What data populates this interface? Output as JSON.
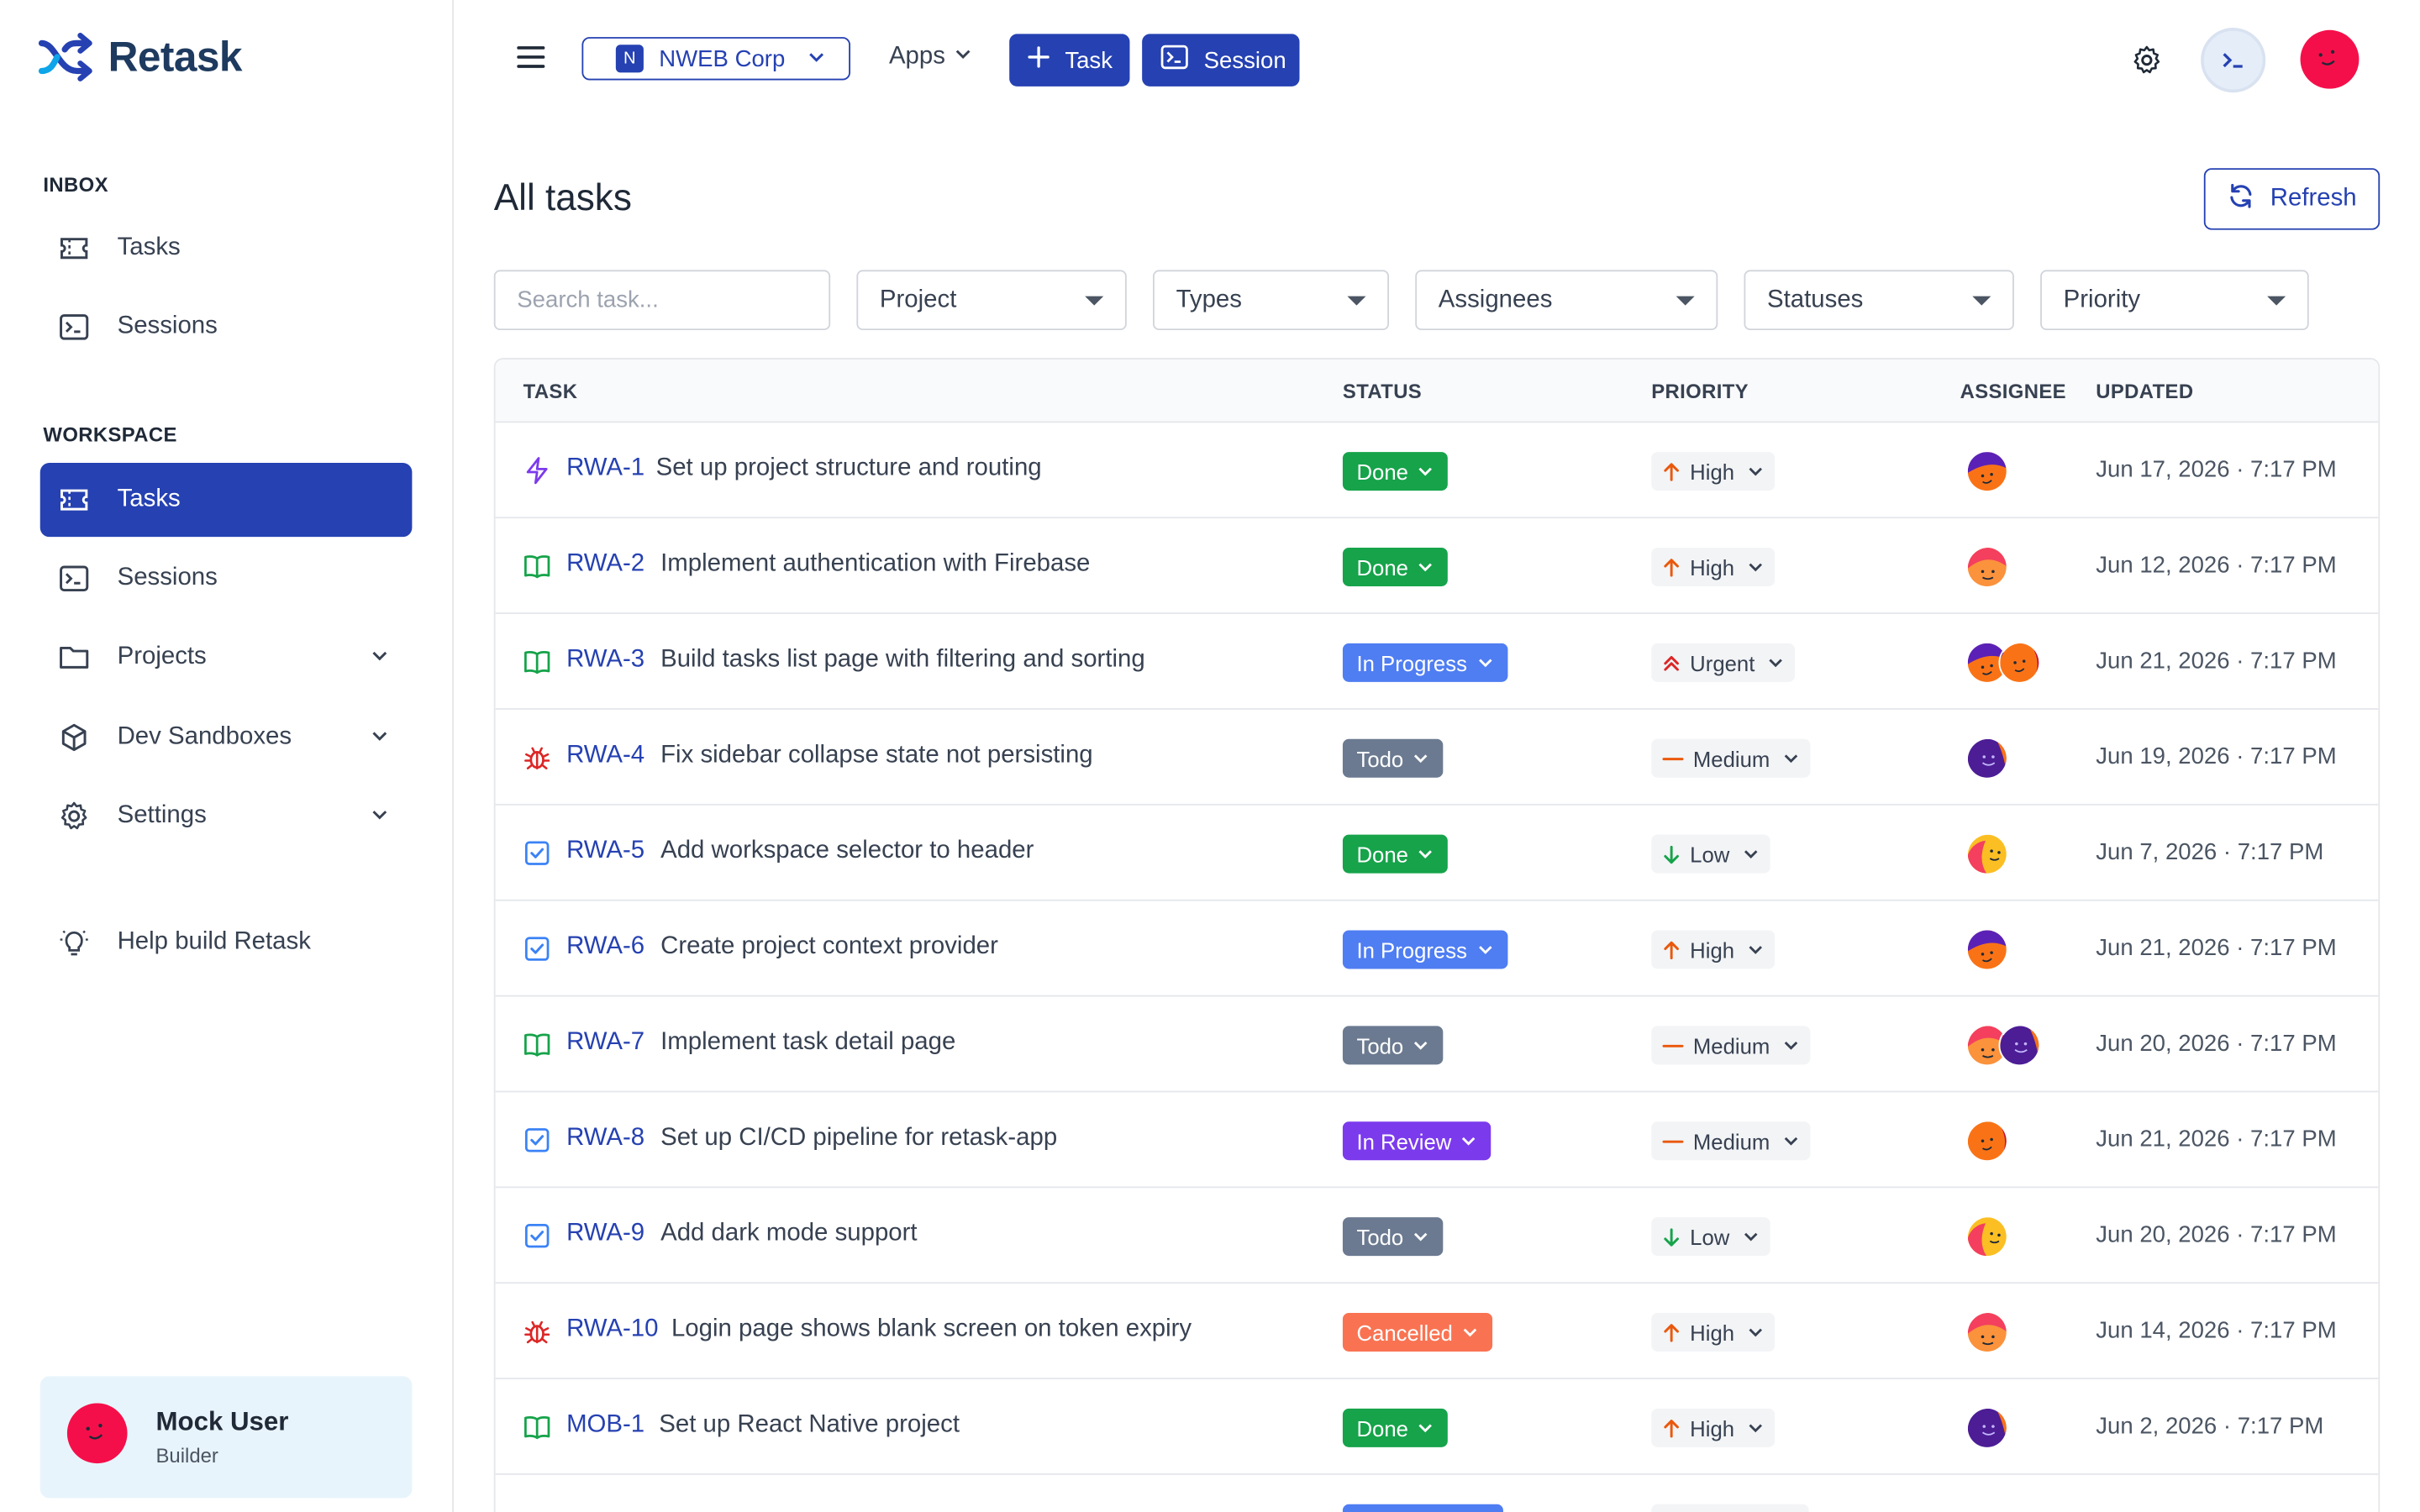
{
  "app": {
    "name": "Retask"
  },
  "sidebar": {
    "inbox_label": "INBOX",
    "inbox_items": [
      {
        "label": "Tasks",
        "icon": "ticket-icon"
      },
      {
        "label": "Sessions",
        "icon": "terminal-icon"
      }
    ],
    "workspace_label": "WORKSPACE",
    "workspace_items": [
      {
        "label": "Tasks",
        "icon": "ticket-icon",
        "active": true
      },
      {
        "label": "Sessions",
        "icon": "terminal-icon"
      },
      {
        "label": "Projects",
        "icon": "folder-icon",
        "expandable": true
      },
      {
        "label": "Dev Sandboxes",
        "icon": "cube-icon",
        "expandable": true
      },
      {
        "label": "Settings",
        "icon": "gear-icon",
        "expandable": true
      }
    ],
    "help_label": "Help build Retask",
    "user": {
      "name": "Mock User",
      "role": "Builder"
    }
  },
  "header": {
    "workspace_initial": "N",
    "workspace_name": "NWEB Corp",
    "apps_label": "Apps",
    "task_button": "Task",
    "session_button": "Session"
  },
  "main": {
    "title": "All tasks",
    "refresh_label": "Refresh",
    "search_placeholder": "Search task...",
    "filters": [
      "Project",
      "Types",
      "Assignees",
      "Statuses",
      "Priority"
    ],
    "columns": [
      "TASK",
      "STATUS",
      "PRIORITY",
      "ASSIGNEE",
      "UPDATED"
    ],
    "rows": [
      {
        "type": "lightning",
        "id": "RWA-1",
        "title": "Set up project structure and routing",
        "status": "Done",
        "priority": "High",
        "assignees": [
          "orange-purple"
        ],
        "updated": "Jun 17, 2026 · 7:17 PM"
      },
      {
        "type": "book",
        "id": "RWA-2",
        "title": "Implement authentication with Firebase",
        "status": "Done",
        "priority": "High",
        "assignees": [
          "orange-pink"
        ],
        "updated": "Jun 12, 2026 · 7:17 PM"
      },
      {
        "type": "book",
        "id": "RWA-3",
        "title": "Build tasks list page with filtering and sorting",
        "status": "In Progress",
        "priority": "Urgent",
        "assignees": [
          "orange-purple",
          "orange-red"
        ],
        "updated": "Jun 21, 2026 · 7:17 PM"
      },
      {
        "type": "bug",
        "id": "RWA-4",
        "title": "Fix sidebar collapse state not persisting",
        "status": "Todo",
        "priority": "Medium",
        "assignees": [
          "purple"
        ],
        "updated": "Jun 19, 2026 · 7:17 PM"
      },
      {
        "type": "check",
        "id": "RWA-5",
        "title": "Add workspace selector to header",
        "status": "Done",
        "priority": "Low",
        "assignees": [
          "pink-yellow"
        ],
        "updated": "Jun 7, 2026 · 7:17 PM"
      },
      {
        "type": "check",
        "id": "RWA-6",
        "title": "Create project context provider",
        "status": "In Progress",
        "priority": "High",
        "assignees": [
          "orange-purple"
        ],
        "updated": "Jun 21, 2026 · 7:17 PM"
      },
      {
        "type": "book",
        "id": "RWA-7",
        "title": "Implement task detail page",
        "status": "Todo",
        "priority": "Medium",
        "assignees": [
          "orange-pink",
          "purple"
        ],
        "updated": "Jun 20, 2026 · 7:17 PM"
      },
      {
        "type": "check",
        "id": "RWA-8",
        "title": "Set up CI/CD pipeline for retask-app",
        "status": "In Review",
        "priority": "Medium",
        "assignees": [
          "orange-red"
        ],
        "updated": "Jun 21, 2026 · 7:17 PM"
      },
      {
        "type": "check",
        "id": "RWA-9",
        "title": "Add dark mode support",
        "status": "Todo",
        "priority": "Low",
        "assignees": [
          "pink-yellow"
        ],
        "updated": "Jun 20, 2026 · 7:17 PM"
      },
      {
        "type": "bug",
        "id": "RWA-10",
        "title": "Login page shows blank screen on token expiry",
        "status": "Cancelled",
        "priority": "High",
        "assignees": [
          "orange-pink"
        ],
        "updated": "Jun 14, 2026 · 7:17 PM"
      },
      {
        "type": "book",
        "id": "MOB-1",
        "title": "Set up React Native project",
        "status": "Done",
        "priority": "High",
        "assignees": [
          "purple"
        ],
        "updated": "Jun 2, 2026 · 7:17 PM"
      }
    ]
  },
  "colors": {
    "brand": "#2541b2",
    "status": {
      "Done": "#16a34a",
      "In Progress": "#4f7df2",
      "Todo": "#6b7a90",
      "In Review": "#7c3aed",
      "Cancelled": "#f97352"
    },
    "priority_icon": {
      "High": "#ea580c",
      "Urgent": "#dc2626",
      "Medium": "#ea580c",
      "Low": "#16a34a"
    }
  }
}
